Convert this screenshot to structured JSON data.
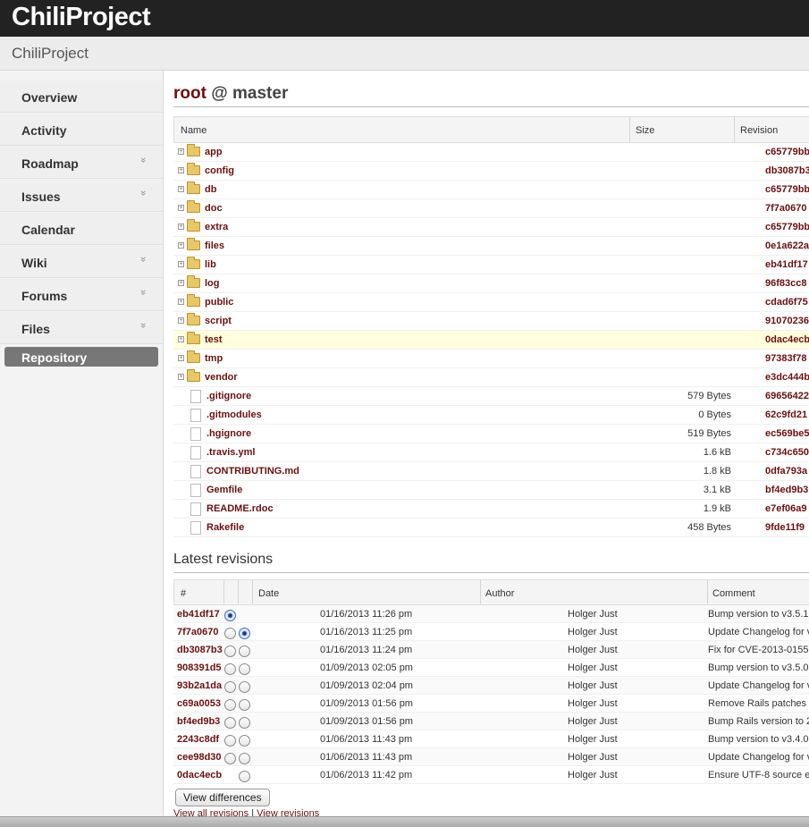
{
  "app": {
    "name": "ChiliProject"
  },
  "project": {
    "name": "ChiliProject"
  },
  "nav": [
    {
      "label": "Overview",
      "dropdown": false
    },
    {
      "label": "Activity",
      "dropdown": false
    },
    {
      "label": "Roadmap",
      "dropdown": true
    },
    {
      "label": "Issues",
      "dropdown": true
    },
    {
      "label": "Calendar",
      "dropdown": false
    },
    {
      "label": "Wiki",
      "dropdown": true
    },
    {
      "label": "Forums",
      "dropdown": true
    },
    {
      "label": "Files",
      "dropdown": true
    },
    {
      "label": "Repository",
      "dropdown": false,
      "selected": true
    }
  ],
  "breadcrumb": {
    "root": "root",
    "sep": "@",
    "branch": "master"
  },
  "files_table": {
    "headers": {
      "name": "Name",
      "size": "Size",
      "revision": "Revision"
    },
    "rows": [
      {
        "type": "dir",
        "name": "app",
        "size": "",
        "rev": "c65779bb"
      },
      {
        "type": "dir",
        "name": "config",
        "size": "",
        "rev": "db3087b3"
      },
      {
        "type": "dir",
        "name": "db",
        "size": "",
        "rev": "c65779bb"
      },
      {
        "type": "dir",
        "name": "doc",
        "size": "",
        "rev": "7f7a0670"
      },
      {
        "type": "dir",
        "name": "extra",
        "size": "",
        "rev": "c65779bb"
      },
      {
        "type": "dir",
        "name": "files",
        "size": "",
        "rev": "0e1a622a"
      },
      {
        "type": "dir",
        "name": "lib",
        "size": "",
        "rev": "eb41df17"
      },
      {
        "type": "dir",
        "name": "log",
        "size": "",
        "rev": "96f83cc8"
      },
      {
        "type": "dir",
        "name": "public",
        "size": "",
        "rev": "cdad6f75"
      },
      {
        "type": "dir",
        "name": "script",
        "size": "",
        "rev": "91070236"
      },
      {
        "type": "dir",
        "name": "test",
        "size": "",
        "rev": "0dac4ecb",
        "highlight": true
      },
      {
        "type": "dir",
        "name": "tmp",
        "size": "",
        "rev": "97383f78"
      },
      {
        "type": "dir",
        "name": "vendor",
        "size": "",
        "rev": "e3dc444b"
      },
      {
        "type": "file",
        "name": ".gitignore",
        "size": "579 Bytes",
        "rev": "69656422"
      },
      {
        "type": "file",
        "name": ".gitmodules",
        "size": "0 Bytes",
        "rev": "62c9fd21"
      },
      {
        "type": "file",
        "name": ".hgignore",
        "size": "519 Bytes",
        "rev": "ec569be5"
      },
      {
        "type": "file",
        "name": ".travis.yml",
        "size": "1.6 kB",
        "rev": "c734c650"
      },
      {
        "type": "file",
        "name": "CONTRIBUTING.md",
        "size": "1.8 kB",
        "rev": "0dfa793a"
      },
      {
        "type": "file",
        "name": "Gemfile",
        "size": "3.1 kB",
        "rev": "bf4ed9b3"
      },
      {
        "type": "file",
        "name": "README.rdoc",
        "size": "1.9 kB",
        "rev": "e7ef06a9"
      },
      {
        "type": "file",
        "name": "Rakefile",
        "size": "458 Bytes",
        "rev": "9fde11f9"
      }
    ]
  },
  "revisions": {
    "title": "Latest revisions",
    "headers": {
      "num": "#",
      "date": "Date",
      "author": "Author",
      "comment": "Comment"
    },
    "rows": [
      {
        "id": "eb41df17",
        "date": "01/16/2013 11:26 pm",
        "author": "Holger Just",
        "comment": "Bump version to v3.5.1",
        "radio1": "on",
        "radio2": "none"
      },
      {
        "id": "7f7a0670",
        "date": "01/16/2013 11:25 pm",
        "author": "Holger Just",
        "comment": "Update Changelog for v",
        "radio1": "off",
        "radio2": "on"
      },
      {
        "id": "db3087b3",
        "date": "01/16/2013 11:24 pm",
        "author": "Holger Just",
        "comment": "Fix for CVE-2013-0155",
        "radio1": "off",
        "radio2": "off"
      },
      {
        "id": "908391d5",
        "date": "01/09/2013 02:05 pm",
        "author": "Holger Just",
        "comment": "Bump version to v3.5.0",
        "radio1": "off",
        "radio2": "off"
      },
      {
        "id": "93b2a1da",
        "date": "01/09/2013 02:04 pm",
        "author": "Holger Just",
        "comment": "Update Changelog for v",
        "radio1": "off",
        "radio2": "off"
      },
      {
        "id": "c69a0053",
        "date": "01/09/2013 01:56 pm",
        "author": "Holger Just",
        "comment": "Remove Rails patches",
        "radio1": "off",
        "radio2": "off"
      },
      {
        "id": "bf4ed9b3",
        "date": "01/09/2013 01:56 pm",
        "author": "Holger Just",
        "comment": "Bump Rails version to 2",
        "radio1": "off",
        "radio2": "off"
      },
      {
        "id": "2243c8df",
        "date": "01/06/2013 11:43 pm",
        "author": "Holger Just",
        "comment": "Bump version to v3.4.0",
        "radio1": "off",
        "radio2": "off"
      },
      {
        "id": "cee98d30",
        "date": "01/06/2013 11:43 pm",
        "author": "Holger Just",
        "comment": "Update Changelog for v",
        "radio1": "off",
        "radio2": "off"
      },
      {
        "id": "0dac4ecb",
        "date": "01/06/2013 11:42 pm",
        "author": "Holger Just",
        "comment": "Ensure UTF-8 source e",
        "radio1": "none",
        "radio2": "off"
      }
    ],
    "button": "View differences",
    "links": {
      "all": "View all revisions",
      "sep": "|",
      "view": "View revisions"
    }
  },
  "colors": {
    "link": "#6d0f0f",
    "topbar": "#222222",
    "highlight": "#ffffdd"
  }
}
